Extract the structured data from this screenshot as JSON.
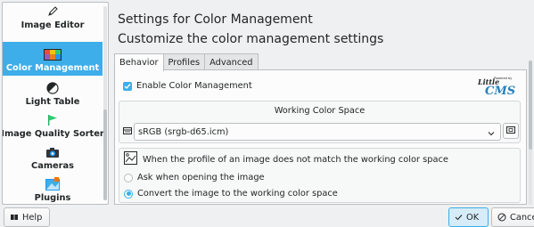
{
  "sidebar": {
    "items": [
      {
        "label": "Image Editor",
        "icon": "pencil-icon"
      },
      {
        "label": "Color Management",
        "icon": "color-palette-icon",
        "active": true
      },
      {
        "label": "Light Table",
        "icon": "contrast-icon"
      },
      {
        "label": "Image Quality Sorter",
        "icon": "flag-icon"
      },
      {
        "label": "Cameras",
        "icon": "camera-icon"
      },
      {
        "label": "Plugins",
        "icon": "plugins-icon"
      }
    ]
  },
  "header": {
    "title": "Settings for Color Management",
    "subtitle": "Customize the color management settings"
  },
  "tabs": [
    "Behavior",
    "Profiles",
    "Advanced"
  ],
  "behavior": {
    "enable_label": "Enable Color Management",
    "enable_checked": true,
    "logo": {
      "main": "Little",
      "sub": "CMS",
      "tag": "Powered by"
    },
    "working_space": {
      "title": "Working Color Space",
      "profile": "sRGB (srgb-d65.icm)"
    },
    "mismatch": {
      "text": "When the profile of an image does not match the working color space",
      "options": [
        {
          "label": "Ask when opening the image",
          "selected": false
        },
        {
          "label": "Convert the image to the working color space",
          "selected": true
        }
      ]
    }
  },
  "buttons": {
    "help": "Help",
    "ok": "OK",
    "cancel": "Cancel"
  },
  "colors": {
    "accent": "#3daee9",
    "window_bg": "#eff0f1",
    "view_bg": "#fcfcfc"
  }
}
